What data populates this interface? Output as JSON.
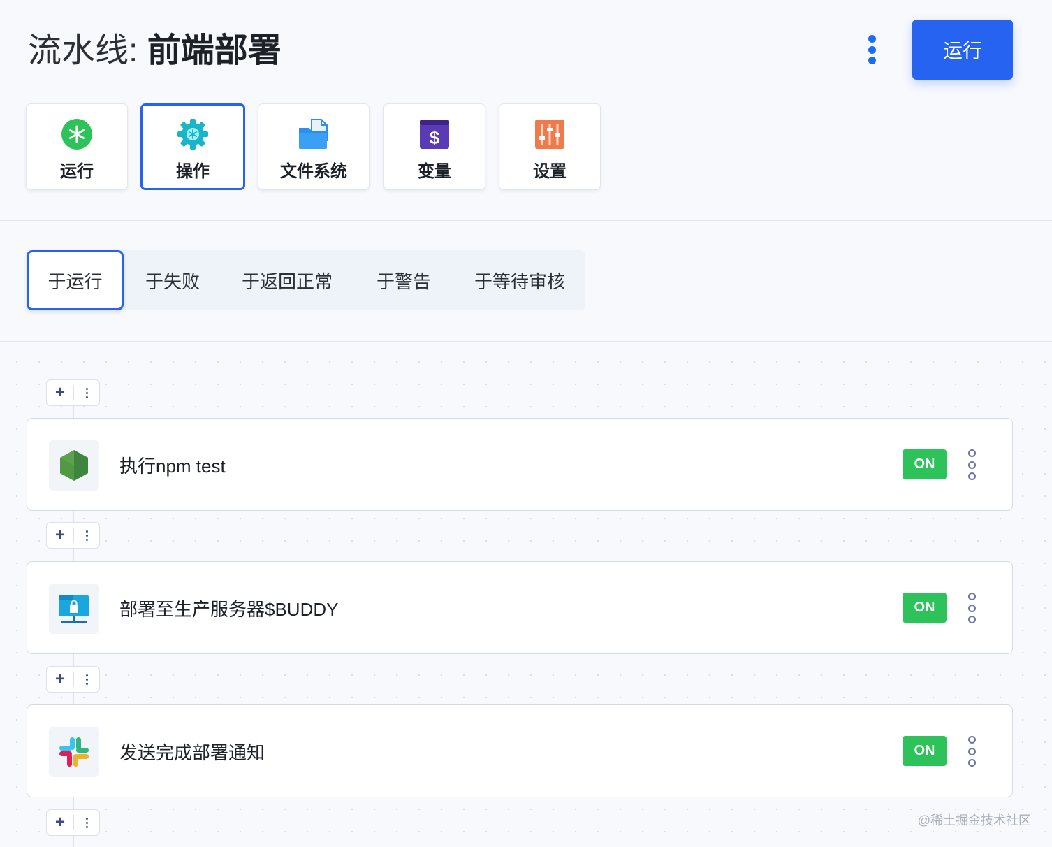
{
  "header": {
    "title_prefix": "流水线: ",
    "title_name": "前端部署",
    "run_button": "运行",
    "more_icon": "kebab-vertical-icon"
  },
  "toolbar": [
    {
      "label": "运行",
      "icon": "asterisk-circle-icon",
      "color": "#2ec25b",
      "active": false
    },
    {
      "label": "操作",
      "icon": "gear-icon",
      "color": "#19b6c9",
      "active": true
    },
    {
      "label": "文件系统",
      "icon": "folder-files-icon",
      "color": "#2a8ff0",
      "active": false
    },
    {
      "label": "变量",
      "icon": "dollar-variable-icon",
      "color": "#5b3ab5",
      "active": false
    },
    {
      "label": "设置",
      "icon": "sliders-settings-icon",
      "color": "#ee7b4b",
      "active": false
    }
  ],
  "trigger_tabs": [
    {
      "label": "于运行",
      "active": true
    },
    {
      "label": "于失败",
      "active": false
    },
    {
      "label": "于返回正常",
      "active": false
    },
    {
      "label": "于警告",
      "active": false
    },
    {
      "label": "于等待审核",
      "active": false
    }
  ],
  "adder": {
    "plus": "+"
  },
  "actions": [
    {
      "name": "执行npm test",
      "icon": "nodejs-hexagon-icon",
      "status": "ON"
    },
    {
      "name": "部署至生产服务器$BUDDY",
      "icon": "sftp-server-lock-icon",
      "status": "ON"
    },
    {
      "name": "发送完成部署通知",
      "icon": "slack-icon",
      "status": "ON"
    }
  ],
  "colors": {
    "accent": "#2563f0",
    "on_badge": "#2ec25b"
  },
  "watermark": "@稀土掘金技术社区"
}
